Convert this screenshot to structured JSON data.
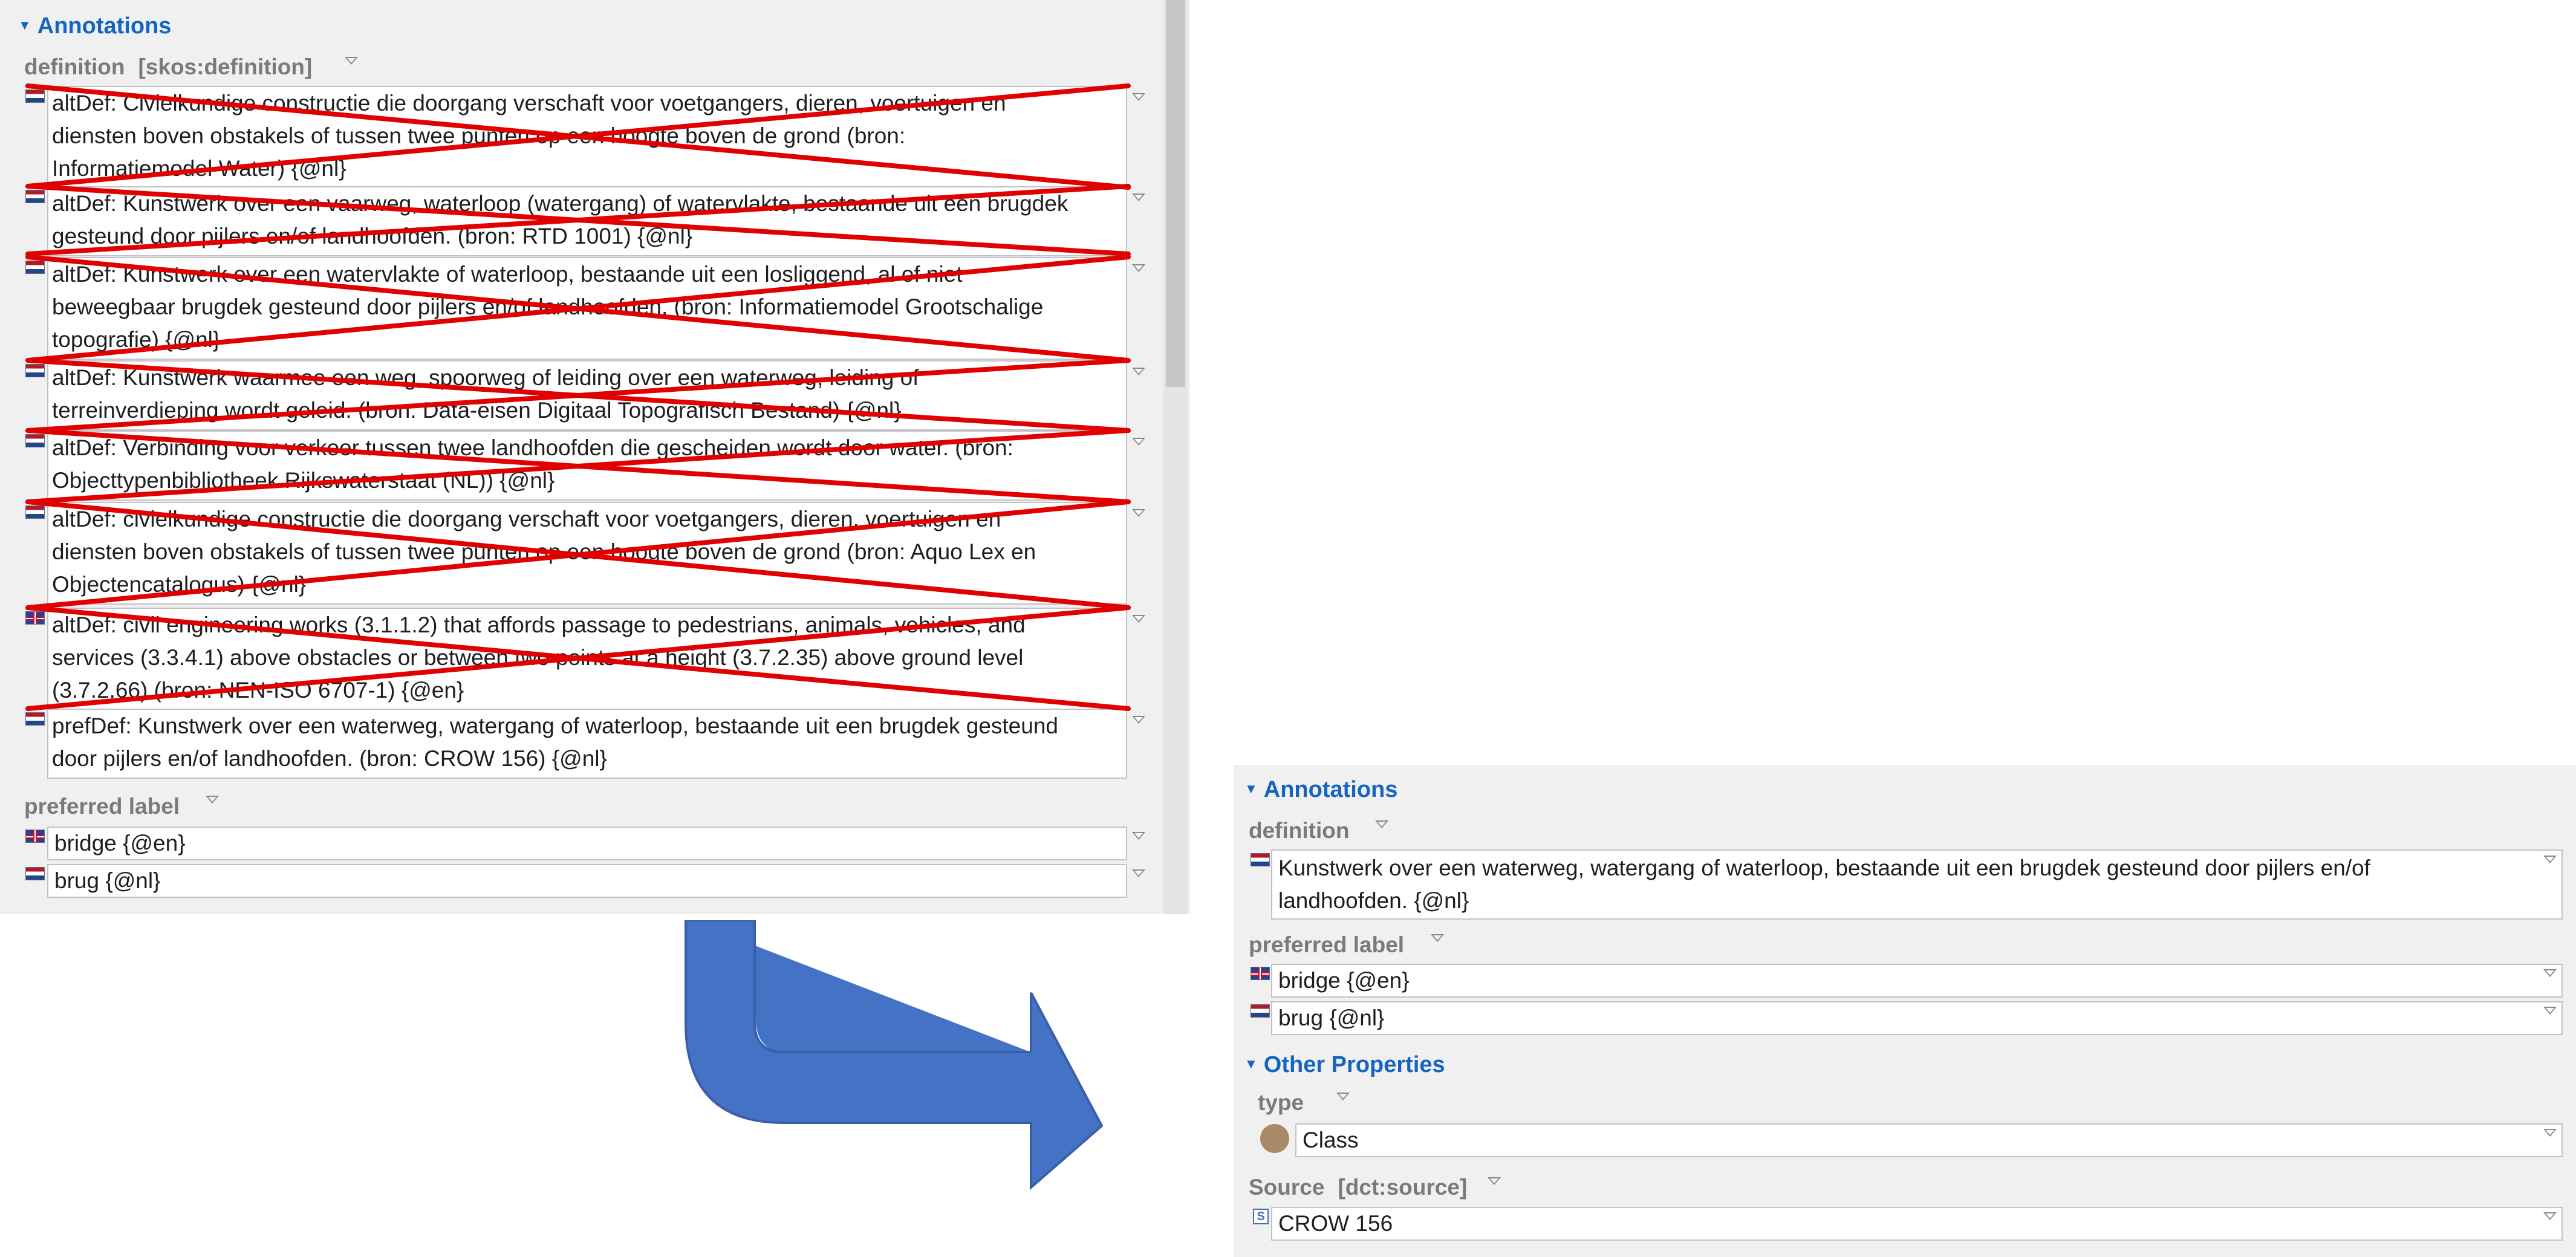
{
  "left_panel": {
    "section_title": "Annotations",
    "definition_label": "definition",
    "definition_qname": "[skos:definition]",
    "definitions": [
      {
        "lang": "nl",
        "lines": [
          "altDef: Civielkundige constructie die doorgang verschaft voor voetgangers, dieren, voertuigen en",
          "diensten boven obstakels of tussen twee punten op een hoogte boven de grond (bron:",
          "Informatiemodel Water) {@nl}"
        ]
      },
      {
        "lang": "nl",
        "lines": [
          "altDef: Kunstwerk over een vaarweg, waterloop (watergang) of watervlakte, bestaande uit een brugdek",
          "gesteund door pijlers en/of landhoofden. (bron: RTD 1001) {@nl}"
        ]
      },
      {
        "lang": "nl",
        "lines": [
          "altDef: Kunstwerk over een watervlakte of waterloop, bestaande uit een losliggend, al of niet",
          "beweegbaar brugdek gesteund door pijlers en/of landhoofden. (bron: Informatiemodel Grootschalige",
          "topografie) {@nl}"
        ]
      },
      {
        "lang": "nl",
        "lines": [
          "altDef: Kunstwerk waarmee een weg, spoorweg of leiding over een waterweg, leiding of",
          "terreinverdieping wordt geleid. (bron: Data-eisen Digitaal Topografisch Bestand) {@nl}"
        ]
      },
      {
        "lang": "nl",
        "lines": [
          "altDef: Verbinding voor verkeer tussen twee landhoofden die gescheiden wordt door water. (bron:",
          "Objecttypenbibliotheek Rijkswaterstaat (NL)) {@nl}"
        ]
      },
      {
        "lang": "nl",
        "lines": [
          "altDef: civielkundige constructie die doorgang verschaft voor voetgangers, dieren, voertuigen en",
          "diensten boven obstakels of tussen twee punten op een hoogte boven de grond (bron: Aquo Lex en",
          "Objectencatalogus) {@nl}"
        ]
      },
      {
        "lang": "en",
        "lines": [
          "altDef: civil engineering works (3.1.1.2) that affords passage to pedestrians, animals, vehicles, and",
          "services (3.3.4.1) above obstacles or between two points at a height (3.7.2.35) above ground level",
          "(3.7.2.66) (bron: NEN-ISO 6707-1) {@en}"
        ]
      },
      {
        "lang": "nl",
        "lines": [
          "prefDef: Kunstwerk over een waterweg, watergang of waterloop, bestaande uit een brugdek gesteund",
          "door pijlers en/of landhoofden. (bron: CROW 156) {@nl}"
        ]
      }
    ],
    "preferred_label_label": "preferred label",
    "preferred_labels": [
      {
        "lang": "en",
        "value": "bridge {@en}"
      },
      {
        "lang": "nl",
        "value": "brug {@nl}"
      }
    ]
  },
  "right_panel": {
    "section_title": "Annotations",
    "definition_label": "definition",
    "definition_lines": [
      "Kunstwerk over een waterweg, watergang of waterloop, bestaande uit een brugdek gesteund door pijlers en/of",
      "landhoofden. {@nl}"
    ],
    "preferred_label_label": "preferred label",
    "preferred_labels": [
      {
        "lang": "en",
        "value": "bridge {@en}"
      },
      {
        "lang": "nl",
        "value": "brug {@nl}"
      }
    ],
    "other_title": "Other Properties",
    "type_label": "type",
    "type_value": "Class",
    "source_label": "Source",
    "source_qname": "[dct:source]",
    "source_value": "CROW 156"
  },
  "colors": {
    "accent_blue": "#1565c0",
    "strike_red": "#e00000",
    "arrow_blue": "#4472c4"
  },
  "icons": [
    "flag-nl-icon",
    "flag-en-icon",
    "dropdown-caret-icon",
    "class-icon",
    "source-icon",
    "collapse-triangle-icon"
  ]
}
